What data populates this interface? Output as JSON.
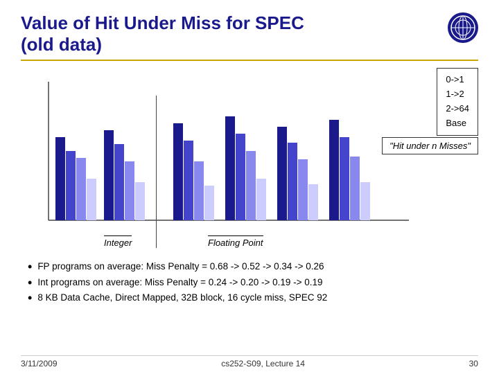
{
  "header": {
    "title_line1": "Value of Hit Under Miss for SPEC",
    "title_line2": "(old data)"
  },
  "legend": {
    "items": [
      "0->1",
      "1->2",
      "2->64",
      "Base"
    ]
  },
  "chart": {
    "hit_under_label": "\"Hit under n Misses\"",
    "x_label_integer": "Integer",
    "x_label_floating": "Floating Point"
  },
  "bullets": [
    {
      "text": "FP programs on average: Miss Penalty = 0.68 -> 0.52 -> 0.34 -> 0.26"
    },
    {
      "text": "Int programs on average: Miss Penalty = 0.24 -> 0.20 -> 0.19 -> 0.19"
    },
    {
      "text": "8 KB Data Cache, Direct Mapped, 32B block, 16 cycle miss, SPEC 92"
    }
  ],
  "footer": {
    "left": "3/11/2009",
    "center": "cs252-S09, Lecture 14",
    "right": "30"
  }
}
